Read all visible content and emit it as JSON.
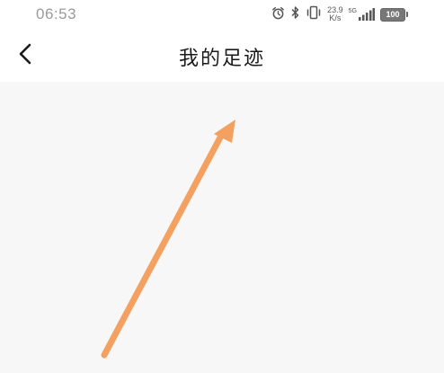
{
  "status_bar": {
    "time": "06:53",
    "net_speed_value": "23.9",
    "net_speed_unit": "K/s",
    "signal_label": "5G",
    "battery": "100",
    "icons": [
      "alarm-icon",
      "bluetooth-icon",
      "vibrate-icon",
      "signal-icon",
      "battery-icon"
    ]
  },
  "header": {
    "back_icon": "chevron-left-icon",
    "title": "我的足迹"
  },
  "annotation": {
    "type": "arrow",
    "color": "#f4a060"
  },
  "colors": {
    "background": "#f7f7f7",
    "header_background": "#ffffff",
    "title_text": "#1a1a1a",
    "status_text": "#9a9a9a"
  }
}
